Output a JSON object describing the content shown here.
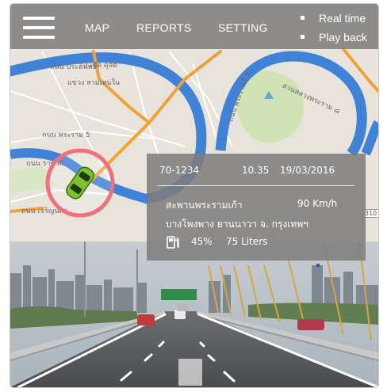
{
  "nav": {
    "menu_icon": "hamburger-menu-icon",
    "items": [
      {
        "label": "MAP"
      },
      {
        "label": "REPORTS"
      },
      {
        "label": "SETTING"
      }
    ],
    "modes": [
      {
        "label": "Real time"
      },
      {
        "label": "Play back"
      }
    ]
  },
  "map": {
    "labels": [
      "ถนน ประดิพัทธิ์",
      "แขวง สามเสนใน",
      "เขต ดุสิต",
      "ถนน พระราม 5",
      "ถนน พระรามที่ 6",
      "สวนหลวงพระราม ๘",
      "ถนน ราชวิถี",
      "ถนน เจริญนคร"
    ],
    "road_tag": "310",
    "colors": {
      "road_major": "#f0a13a",
      "river": "#3f82d6",
      "park": "#cfe3b5",
      "land": "#e8e4dc"
    }
  },
  "vehicle": {
    "icon": "green-car-icon",
    "colors": {
      "body": "#7dc12e",
      "halo": "#f26f7c"
    }
  },
  "info_panel": {
    "plate": "70-1234",
    "time": "10.35",
    "date": "19/03/2016",
    "location": "สะพานพระรามเก้า",
    "speed": "90 Km/h",
    "address": "บางโพงพาง ยานนาวา จ. กรุงเทพฯ",
    "fuel_icon": "fuel-pump-icon",
    "fuel_percent": "45%",
    "fuel_liters": "75 Liters"
  }
}
